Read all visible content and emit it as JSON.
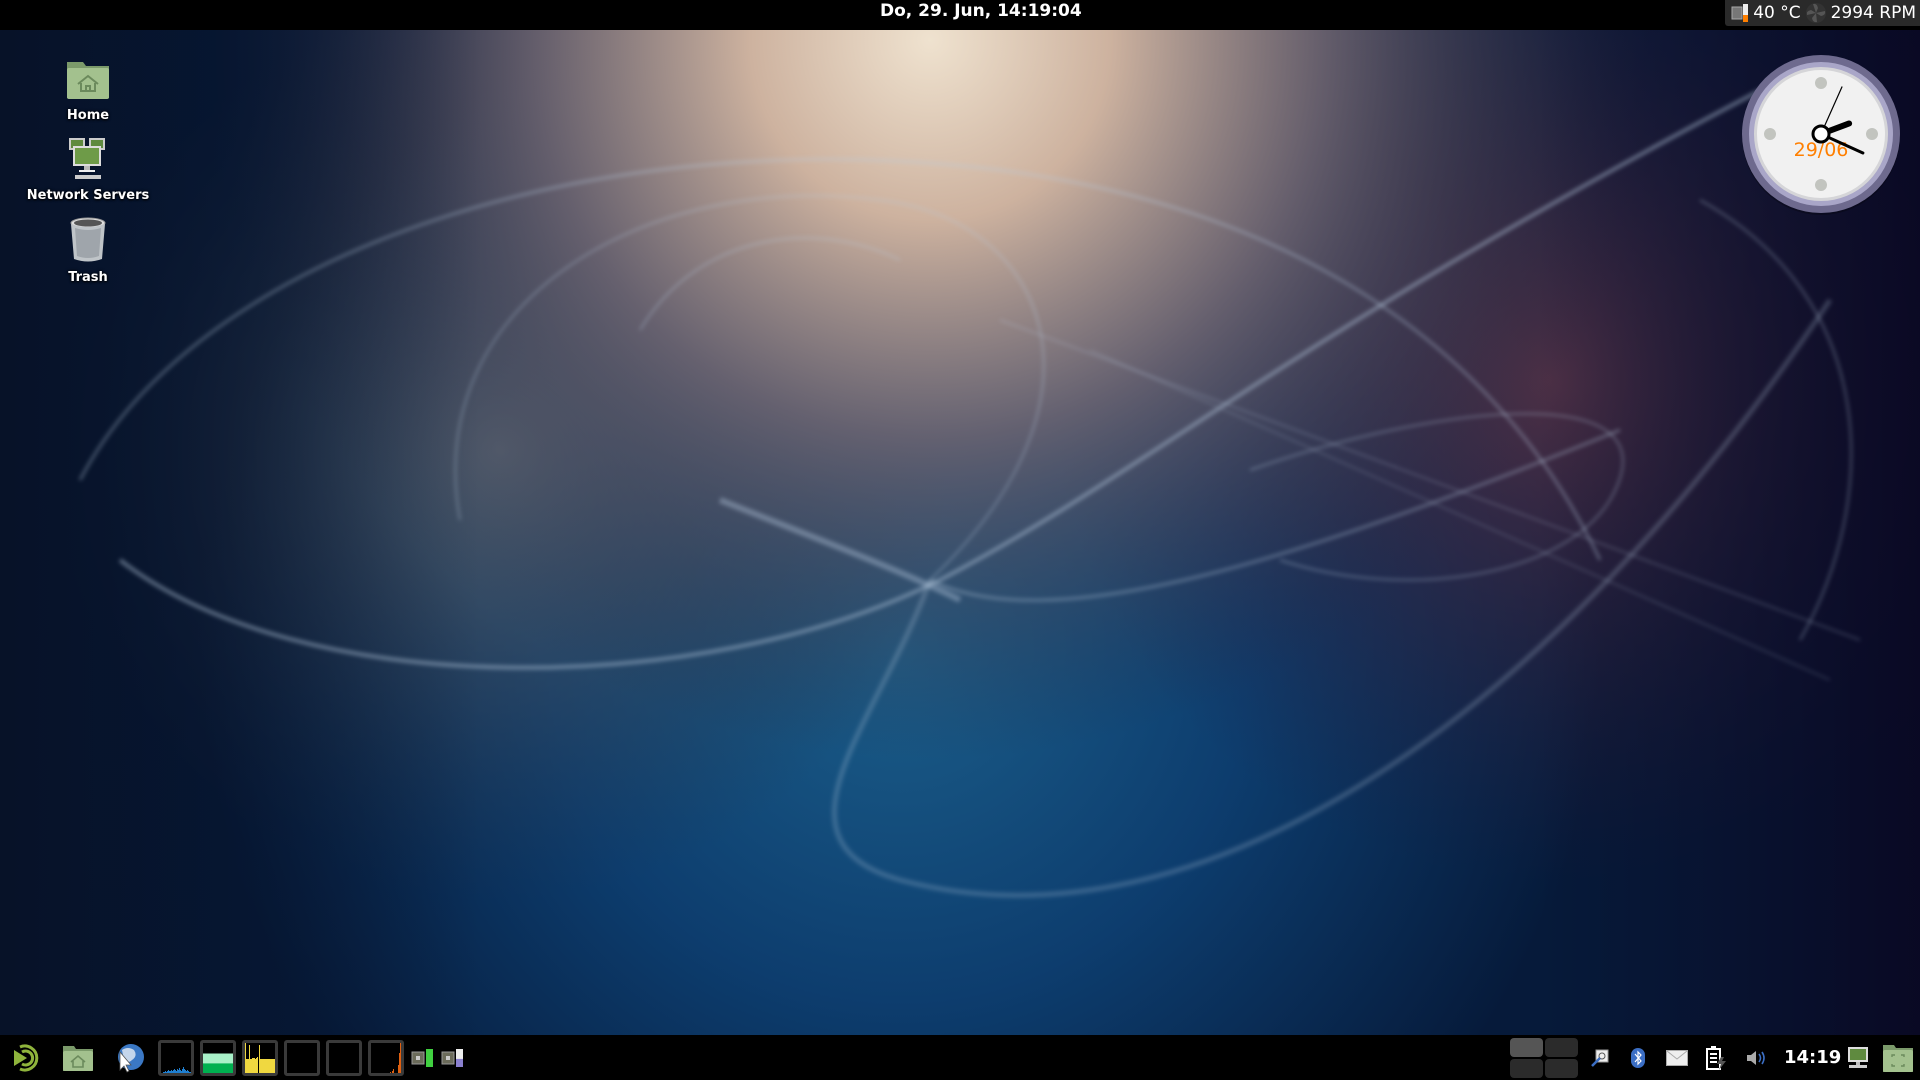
{
  "topbar": {
    "datetime": "Do, 29. Jun, 14:19:04",
    "temperature": "40 °C",
    "fan_speed": "2994 RPM"
  },
  "desktop": {
    "icons": [
      {
        "label": "Home",
        "icon": "home-folder-icon"
      },
      {
        "label": "Network Servers",
        "icon": "network-servers-icon"
      },
      {
        "label": "Trash",
        "icon": "trash-icon"
      }
    ]
  },
  "clock_widget": {
    "date": "29/06",
    "time": "14:19:04",
    "date_color": "#ff7f00"
  },
  "taskbar": {
    "launchers": [
      "menu-icon",
      "home-folder-icon",
      "web-browser-icon"
    ],
    "monitors": [
      {
        "name": "cpu-monitor",
        "color": "#1f7fd0"
      },
      {
        "name": "memory-monitor",
        "color": "#00b050",
        "secondary": "#a8f0c8",
        "used_fraction": 0.32,
        "cached_fraction": 0.65
      },
      {
        "name": "network-monitor",
        "color": "#f0d840"
      },
      {
        "name": "swap-monitor",
        "color": "#000000"
      },
      {
        "name": "load-monitor",
        "color": "#000000"
      },
      {
        "name": "disk-monitor",
        "color": "#e06010"
      }
    ],
    "sensor_indicators": [
      {
        "name": "cpu-frequency-indicator",
        "level": 1.0,
        "color": "#40d040"
      },
      {
        "name": "cpu-usage-indicator",
        "level": 0.45,
        "color": "#8a80d0"
      }
    ],
    "workspaces": {
      "count": 4,
      "active": 1
    },
    "tray": [
      "network-manager-icon",
      "bluetooth-icon",
      "mail-icon",
      "battery-icon",
      "volume-icon"
    ],
    "clock": "14:19",
    "tray_end": [
      "show-desktop-icon",
      "files-icon"
    ]
  }
}
